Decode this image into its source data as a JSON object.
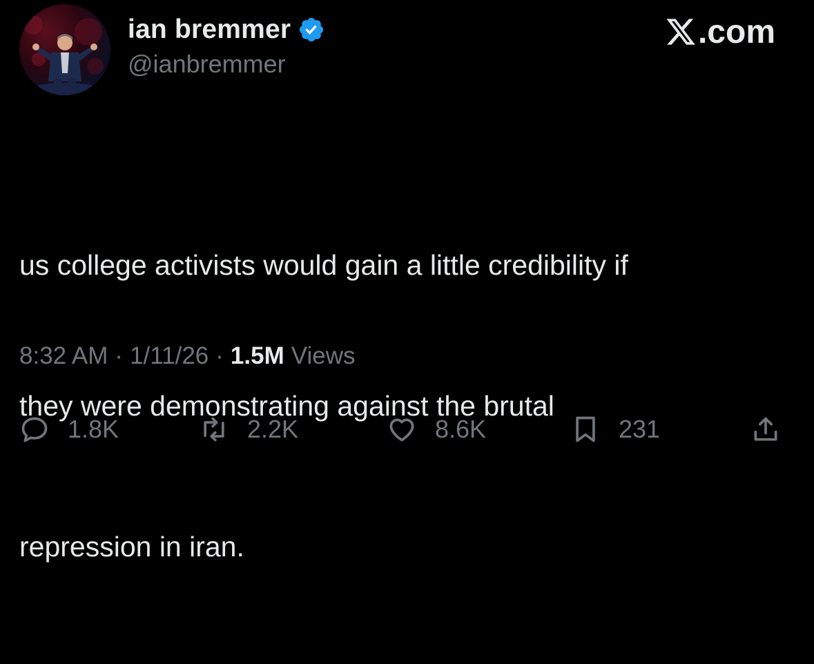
{
  "author": {
    "display_name": "ian bremmer",
    "handle": "@ianbremmer",
    "verified": true,
    "verified_color": "#1d9bf0"
  },
  "brand": {
    "label": ".com",
    "logo": "x-logo-icon"
  },
  "tweet": {
    "lines": [
      "us college activists would gain a little credibility if",
      "they were demonstrating against the brutal",
      "repression in iran."
    ]
  },
  "meta": {
    "time": "8:32 AM",
    "separator": "·",
    "date": "1/11/26",
    "views_count": "1.5M",
    "views_label": "Views"
  },
  "actions": {
    "replies": "1.8K",
    "reposts": "2.2K",
    "likes": "8.6K",
    "bookmarks": "231",
    "icons": [
      "reply-icon",
      "repost-icon",
      "like-icon",
      "bookmark-icon",
      "share-icon"
    ]
  },
  "colors": {
    "background": "#000000",
    "text_primary": "#e7e9ea",
    "text_secondary": "#71767b"
  }
}
